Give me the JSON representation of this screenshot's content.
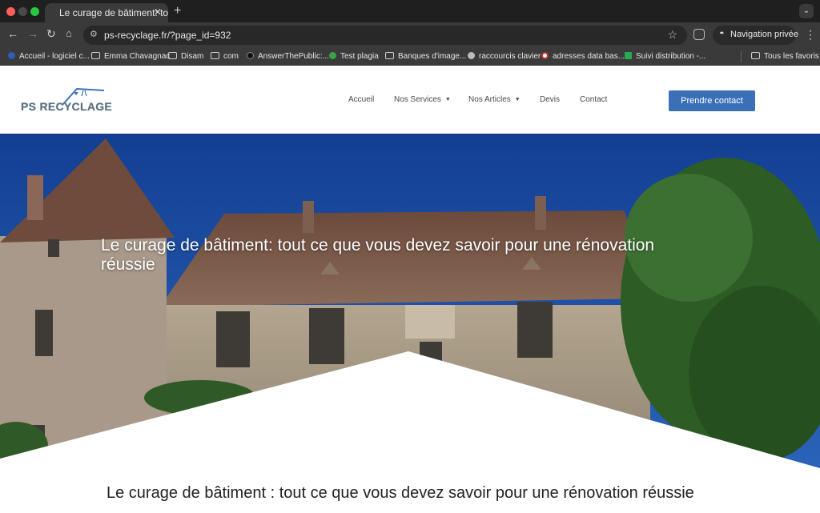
{
  "browser": {
    "tab_title": "Le curage de bâtiment: tout c",
    "url": "ps-recyclage.fr/?page_id=932",
    "private_label": "Navigation privée",
    "bookmarks": [
      {
        "label": "Accueil - logiciel c...",
        "icon": "site-icon"
      },
      {
        "label": "Emma Chavagnac",
        "icon": "folder-icon"
      },
      {
        "label": "Disam",
        "icon": "folder-icon"
      },
      {
        "label": "com",
        "icon": "folder-icon"
      },
      {
        "label": "AnswerThePublic:...",
        "icon": "site-icon"
      },
      {
        "label": "Test plagia",
        "icon": "site-icon"
      },
      {
        "label": "Banques d'image...",
        "icon": "folder-icon"
      },
      {
        "label": "raccourcis clavier",
        "icon": "apple-icon"
      },
      {
        "label": "adresses data bas...",
        "icon": "site-icon"
      },
      {
        "label": "Suivi distribution -...",
        "icon": "sheets-icon"
      }
    ],
    "all_favorites": "Tous les favoris"
  },
  "site": {
    "logo_text": "PS RECYCLAGE",
    "nav": {
      "accueil": "Accueil",
      "services": "Nos Services",
      "articles": "Nos Articles",
      "devis": "Devis",
      "contact": "Contact"
    },
    "cta": "Prendre contact"
  },
  "hero": {
    "title": "Le curage de bâtiment: tout ce que vous devez savoir pour une rénovation réussie"
  },
  "article": {
    "title": "Le curage de bâtiment : tout ce que vous devez savoir pour une rénovation réussie"
  },
  "colors": {
    "brand_button": "#3b70b8",
    "sky": "#1c4ea6"
  }
}
